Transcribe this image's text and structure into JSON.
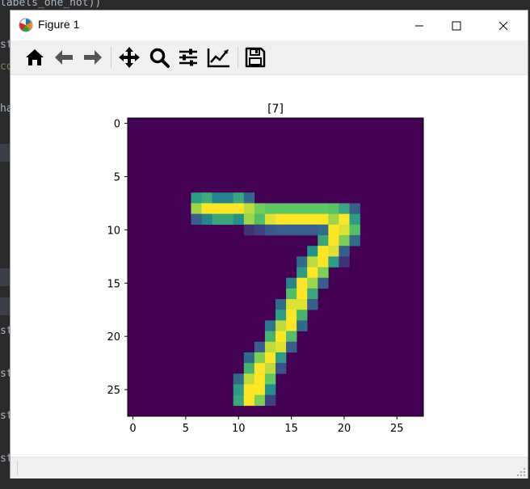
{
  "background_code": {
    "top_line": "labels_one_hot))",
    "left_fragments": [
      "st",
      "co",
      "ha",
      "st",
      "st",
      "st",
      "st"
    ]
  },
  "window": {
    "title": "Figure 1"
  },
  "toolbar": {
    "buttons": [
      "home-icon",
      "back-arrow-icon",
      "forward-arrow-icon",
      "pan-icon",
      "zoom-icon",
      "configure-subplots-icon",
      "edit-axis-icon",
      "save-icon"
    ]
  },
  "colors": {
    "viridis_dark": "#440154",
    "viridis_blue": "#3b528b",
    "viridis_teal": "#21918c",
    "viridis_green": "#5ec962",
    "viridis_yellow": "#fde725",
    "toolbar_bg": "#f0f0f0"
  },
  "chart_data": {
    "type": "heatmap",
    "title": "[7]",
    "xlabel": "",
    "ylabel": "",
    "xlim": [
      -0.5,
      27.5
    ],
    "ylim": [
      27.5,
      -0.5
    ],
    "x_ticks": [
      0,
      5,
      10,
      15,
      20,
      25
    ],
    "y_ticks": [
      0,
      5,
      10,
      15,
      20,
      25
    ],
    "colormap": "viridis",
    "grid": false,
    "width": 28,
    "height": 28,
    "pixels": [
      [
        6,
        7,
        0.55
      ],
      [
        7,
        7,
        0.62
      ],
      [
        8,
        7,
        0.45
      ],
      [
        9,
        7,
        0.45
      ],
      [
        10,
        7,
        0.6
      ],
      [
        11,
        7,
        0.35
      ],
      [
        6,
        8,
        0.85
      ],
      [
        7,
        8,
        1
      ],
      [
        8,
        8,
        1
      ],
      [
        9,
        8,
        1
      ],
      [
        10,
        8,
        1
      ],
      [
        11,
        8,
        0.9
      ],
      [
        12,
        8,
        0.78
      ],
      [
        13,
        8,
        0.75
      ],
      [
        14,
        8,
        0.75
      ],
      [
        15,
        8,
        0.75
      ],
      [
        16,
        8,
        0.75
      ],
      [
        17,
        8,
        0.75
      ],
      [
        18,
        8,
        0.75
      ],
      [
        19,
        8,
        0.72
      ],
      [
        20,
        8,
        0.6
      ],
      [
        21,
        8,
        0.3
      ],
      [
        6,
        9,
        0.3
      ],
      [
        7,
        9,
        0.45
      ],
      [
        8,
        9,
        0.6
      ],
      [
        9,
        9,
        0.6
      ],
      [
        10,
        9,
        0.5
      ],
      [
        11,
        9,
        0.85
      ],
      [
        12,
        9,
        0.7
      ],
      [
        13,
        9,
        0.95
      ],
      [
        14,
        9,
        1
      ],
      [
        15,
        9,
        1
      ],
      [
        16,
        9,
        1
      ],
      [
        17,
        9,
        1
      ],
      [
        18,
        9,
        1
      ],
      [
        19,
        9,
        0.85
      ],
      [
        20,
        9,
        1
      ],
      [
        21,
        9,
        0.55
      ],
      [
        11,
        10,
        0.15
      ],
      [
        12,
        10,
        0.2
      ],
      [
        13,
        10,
        0.28
      ],
      [
        14,
        10,
        0.3
      ],
      [
        15,
        10,
        0.3
      ],
      [
        16,
        10,
        0.3
      ],
      [
        17,
        10,
        0.3
      ],
      [
        18,
        10,
        0.35
      ],
      [
        19,
        10,
        1
      ],
      [
        20,
        10,
        0.95
      ],
      [
        21,
        10,
        0.7
      ],
      [
        18,
        11,
        0.6
      ],
      [
        19,
        11,
        1
      ],
      [
        20,
        11,
        0.8
      ],
      [
        21,
        11,
        0.35
      ],
      [
        17,
        12,
        0.5
      ],
      [
        18,
        12,
        1
      ],
      [
        19,
        12,
        0.95
      ],
      [
        20,
        12,
        0.3
      ],
      [
        16,
        13,
        0.35
      ],
      [
        17,
        13,
        0.9
      ],
      [
        18,
        13,
        1
      ],
      [
        19,
        13,
        0.55
      ],
      [
        20,
        13,
        0.15
      ],
      [
        16,
        14,
        0.55
      ],
      [
        17,
        14,
        1
      ],
      [
        18,
        14,
        0.8
      ],
      [
        15,
        15,
        0.45
      ],
      [
        16,
        15,
        1
      ],
      [
        17,
        15,
        0.85
      ],
      [
        18,
        15,
        0.3
      ],
      [
        15,
        16,
        0.7
      ],
      [
        16,
        16,
        1
      ],
      [
        17,
        16,
        0.6
      ],
      [
        14,
        17,
        0.35
      ],
      [
        15,
        17,
        0.95
      ],
      [
        16,
        17,
        0.95
      ],
      [
        17,
        17,
        0.3
      ],
      [
        14,
        18,
        0.55
      ],
      [
        15,
        18,
        1
      ],
      [
        16,
        18,
        0.65
      ],
      [
        13,
        19,
        0.4
      ],
      [
        14,
        19,
        0.9
      ],
      [
        15,
        19,
        1
      ],
      [
        16,
        19,
        0.35
      ],
      [
        13,
        20,
        0.65
      ],
      [
        14,
        20,
        1
      ],
      [
        15,
        20,
        0.7
      ],
      [
        12,
        21,
        0.3
      ],
      [
        13,
        21,
        0.9
      ],
      [
        14,
        21,
        0.95
      ],
      [
        15,
        21,
        0.3
      ],
      [
        11,
        22,
        0.35
      ],
      [
        12,
        22,
        0.8
      ],
      [
        13,
        22,
        1
      ],
      [
        14,
        22,
        0.55
      ],
      [
        11,
        23,
        0.65
      ],
      [
        12,
        23,
        1
      ],
      [
        13,
        23,
        0.9
      ],
      [
        14,
        23,
        0.25
      ],
      [
        10,
        24,
        0.35
      ],
      [
        11,
        24,
        0.9
      ],
      [
        12,
        24,
        1
      ],
      [
        13,
        24,
        0.75
      ],
      [
        10,
        25,
        0.55
      ],
      [
        11,
        25,
        1
      ],
      [
        12,
        25,
        1
      ],
      [
        13,
        25,
        0.5
      ],
      [
        10,
        26,
        0.6
      ],
      [
        11,
        26,
        1
      ],
      [
        12,
        26,
        0.8
      ],
      [
        13,
        26,
        0.2
      ]
    ]
  }
}
